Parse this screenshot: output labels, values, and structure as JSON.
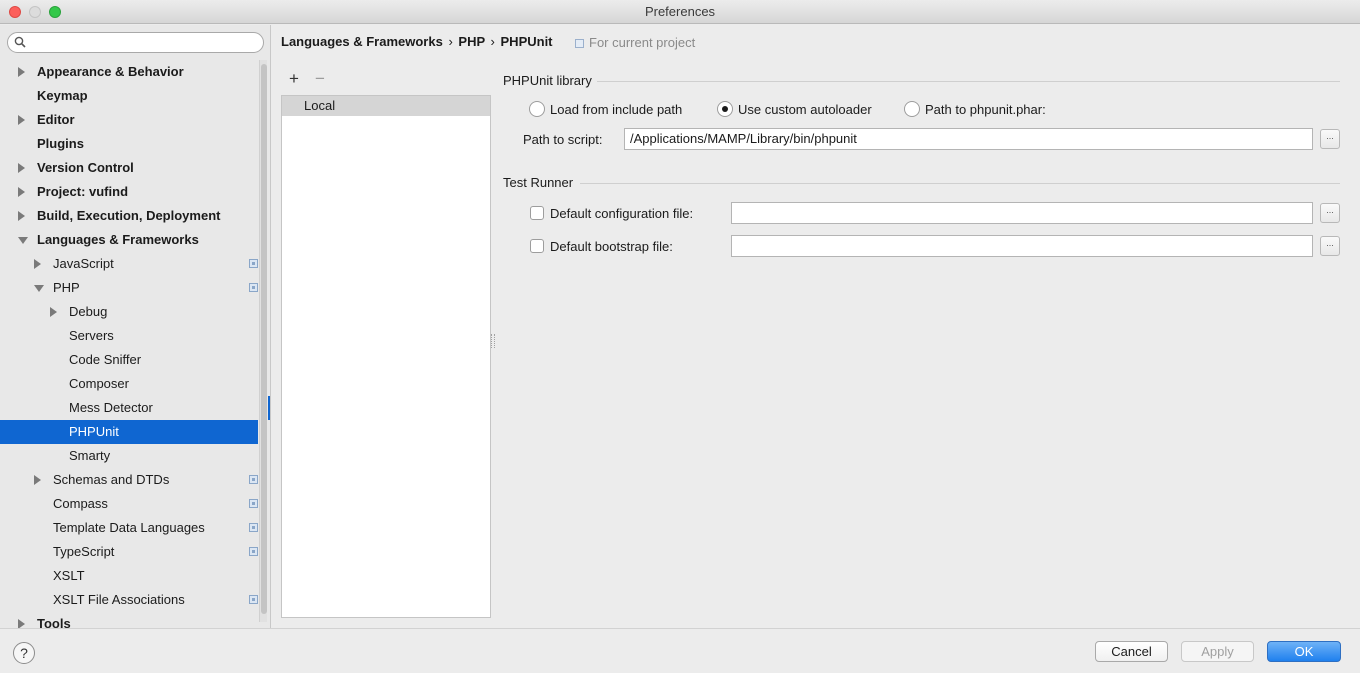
{
  "window": {
    "title": "Preferences"
  },
  "search": {
    "placeholder": ""
  },
  "sidebar": {
    "items": [
      {
        "label": "Appearance & Behavior",
        "level": 0,
        "bold": true,
        "expander": "collapsed",
        "project": false
      },
      {
        "label": "Keymap",
        "level": 0,
        "bold": true,
        "expander": "none",
        "project": false
      },
      {
        "label": "Editor",
        "level": 0,
        "bold": true,
        "expander": "collapsed",
        "project": false
      },
      {
        "label": "Plugins",
        "level": 0,
        "bold": true,
        "expander": "none",
        "project": false
      },
      {
        "label": "Version Control",
        "level": 0,
        "bold": true,
        "expander": "collapsed",
        "project": false
      },
      {
        "label": "Project: vufind",
        "level": 0,
        "bold": true,
        "expander": "collapsed",
        "project": false
      },
      {
        "label": "Build, Execution, Deployment",
        "level": 0,
        "bold": true,
        "expander": "collapsed",
        "project": false
      },
      {
        "label": "Languages & Frameworks",
        "level": 0,
        "bold": true,
        "expander": "expanded",
        "project": false
      },
      {
        "label": "JavaScript",
        "level": 1,
        "bold": false,
        "expander": "collapsed",
        "project": true
      },
      {
        "label": "PHP",
        "level": 1,
        "bold": false,
        "expander": "expanded",
        "project": true
      },
      {
        "label": "Debug",
        "level": 2,
        "bold": false,
        "expander": "collapsed",
        "project": false
      },
      {
        "label": "Servers",
        "level": 2,
        "bold": false,
        "expander": "none",
        "project": false
      },
      {
        "label": "Code Sniffer",
        "level": 2,
        "bold": false,
        "expander": "none",
        "project": false
      },
      {
        "label": "Composer",
        "level": 2,
        "bold": false,
        "expander": "none",
        "project": false
      },
      {
        "label": "Mess Detector",
        "level": 2,
        "bold": false,
        "expander": "none",
        "project": false
      },
      {
        "label": "PHPUnit",
        "level": 2,
        "bold": false,
        "expander": "none",
        "project": false,
        "selected": true
      },
      {
        "label": "Smarty",
        "level": 2,
        "bold": false,
        "expander": "none",
        "project": false
      },
      {
        "label": "Schemas and DTDs",
        "level": 1,
        "bold": false,
        "expander": "collapsed",
        "project": true
      },
      {
        "label": "Compass",
        "level": 1,
        "bold": false,
        "expander": "none",
        "project": true
      },
      {
        "label": "Template Data Languages",
        "level": 1,
        "bold": false,
        "expander": "none",
        "project": true
      },
      {
        "label": "TypeScript",
        "level": 1,
        "bold": false,
        "expander": "none",
        "project": true
      },
      {
        "label": "XSLT",
        "level": 1,
        "bold": false,
        "expander": "none",
        "project": false
      },
      {
        "label": "XSLT File Associations",
        "level": 1,
        "bold": false,
        "expander": "none",
        "project": true
      },
      {
        "label": "Tools",
        "level": 0,
        "bold": true,
        "expander": "collapsed",
        "project": false
      }
    ]
  },
  "breadcrumb": {
    "part1": "Languages & Frameworks",
    "sep1": "›",
    "part2": "PHP",
    "sep2": "›",
    "part3": "PHPUnit"
  },
  "scope": {
    "label": "For current project"
  },
  "interpreters": {
    "add": "+",
    "remove": "−",
    "items": [
      "Local"
    ]
  },
  "phpunit_library": {
    "title": "PHPUnit library",
    "options": [
      {
        "label": "Load from include path",
        "checked": false
      },
      {
        "label": "Use custom autoloader",
        "checked": true
      },
      {
        "label": "Path to phpunit.phar:",
        "checked": false
      }
    ],
    "path_label": "Path to script:",
    "path_value": "/Applications/MAMP/Library/bin/phpunit",
    "browse": "..."
  },
  "test_runner": {
    "title": "Test Runner",
    "config_label": "Default configuration file:",
    "config_value": "",
    "bootstrap_label": "Default bootstrap file:",
    "bootstrap_value": "",
    "browse": "..."
  },
  "footer": {
    "help": "?",
    "cancel": "Cancel",
    "apply": "Apply",
    "ok": "OK"
  }
}
